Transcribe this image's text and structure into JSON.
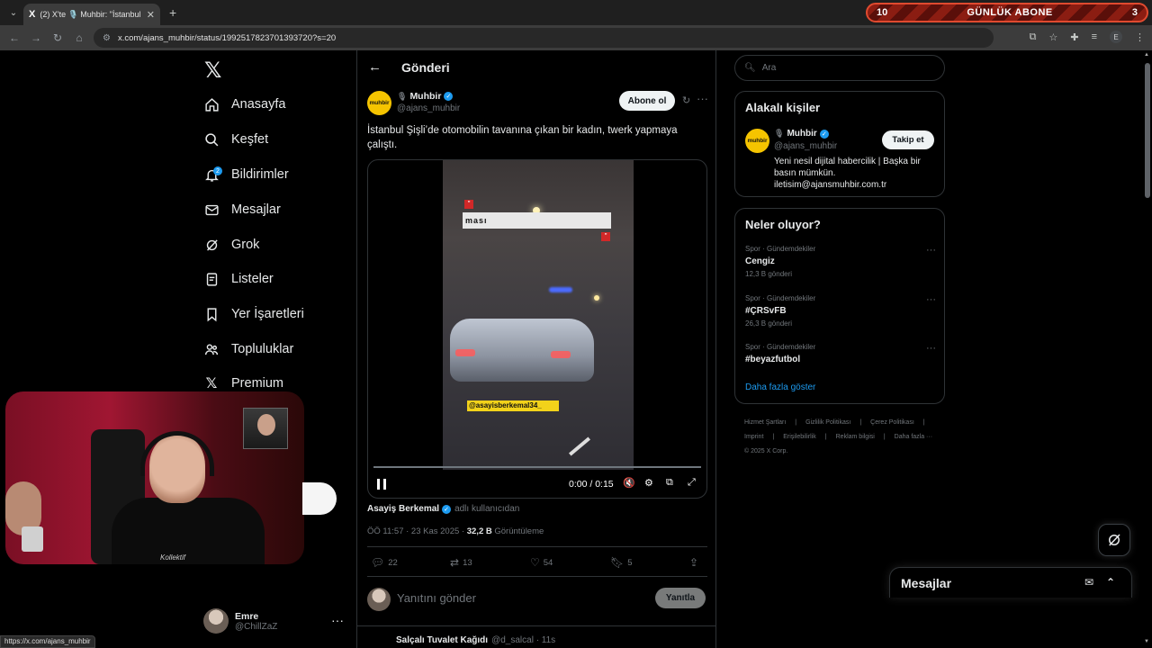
{
  "browser": {
    "tab_title": "(2) X'te 🎙️ Muhbir: \"İstanbul Şi",
    "tab_icon": "X",
    "url": "x.com/ajans_muhbir/status/1992517823701393720?s=20",
    "status_url": "https://x.com/ajans_muhbir",
    "profile_initial": "E"
  },
  "sub_banner": {
    "left": "10",
    "title": "GÜNLÜK ABONE",
    "right": "3"
  },
  "nav": {
    "logo": "𝕏",
    "items": [
      {
        "label": "Anasayfa",
        "icon": "home-icon"
      },
      {
        "label": "Keşfet",
        "icon": "search-icon"
      },
      {
        "label": "Bildirimler",
        "icon": "bell-icon",
        "badge": "2"
      },
      {
        "label": "Mesajlar",
        "icon": "mail-icon"
      },
      {
        "label": "Grok",
        "icon": "grok-icon"
      },
      {
        "label": "Listeler",
        "icon": "list-icon"
      },
      {
        "label": "Yer İşaretleri",
        "icon": "bookmark-icon"
      },
      {
        "label": "Topluluklar",
        "icon": "community-icon"
      },
      {
        "label": "Premium",
        "icon": "x-icon"
      }
    ]
  },
  "account": {
    "name": "Emre",
    "handle": "@ChillZaZ"
  },
  "main": {
    "header_title": "Gönderi",
    "post": {
      "avatar_text": "muhbir",
      "author": "Muhbir",
      "handle": "@ajans_muhbir",
      "follow_label": "Abone ol",
      "text": "İstanbul Şişli’de otomobilin tavanına çıkan bir kadın, twerk yapmaya çalıştı.",
      "video": {
        "caption": "ması",
        "tag": "@asayisberkemal34_",
        "time": "0:00 / 0:15",
        "progress": 0.0
      },
      "credit_name": "Asayiş Berkemal",
      "credit_sub": "adlı kullanıcıdan",
      "timestamp": "ÖÖ 11:57 · 23 Kas 2025 · ",
      "views": "32,2 B",
      "views_label": "Görüntüleme",
      "stats": {
        "replies": "22",
        "reposts": "13",
        "likes": "54",
        "bookmarks": "5"
      }
    },
    "reply": {
      "placeholder": "Yanıtını gönder",
      "button": "Yanıtla"
    },
    "next_post": {
      "author": "Salçalı Tuvalet Kağıdı",
      "meta": "@d_salcal · 11s"
    }
  },
  "right": {
    "search_placeholder": "Ara",
    "related": {
      "title": "Alakalı kişiler",
      "name": "Muhbir",
      "handle": "@ajans_muhbir",
      "follow_label": "Takip et",
      "bio": "Yeni nesil dijital habercilik | Başka bir basın mümkün. iletisim@ajansmuhbir.com.tr"
    },
    "trends": {
      "title": "Neler oluyor?",
      "items": [
        {
          "category": "Spor · Gündemdekiler",
          "name": "Cengiz",
          "posts": "12,3 B gönderi"
        },
        {
          "category": "Spor · Gündemdekiler",
          "name": "#ÇRSvFB",
          "posts": "26,3 B gönderi"
        },
        {
          "category": "Spor · Gündemdekiler",
          "name": "#beyazfutbol",
          "posts": ""
        }
      ],
      "show_more": "Daha fazla göster"
    },
    "footer": {
      "links": [
        "Hizmet Şartları",
        "|",
        "Gizlilik Politikası",
        "|",
        "Çerez Politikası",
        "|",
        "Imprint",
        "|",
        "Erişilebilirlik",
        "|",
        "Reklam bilgisi",
        "|",
        "Daha fazla ···"
      ],
      "copyright": "© 2025 X Corp."
    }
  },
  "messages_drawer": {
    "title": "Mesajlar"
  },
  "webcam": {
    "shirt_text": "Kollektif"
  },
  "colors": {
    "accent": "#1d9bf0",
    "background": "#000000",
    "muted": "#71767b",
    "banner": "#8b1d12"
  }
}
